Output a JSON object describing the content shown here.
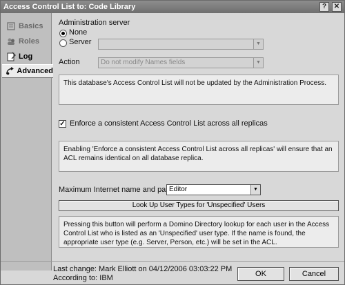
{
  "window": {
    "title": "Access Control List to: Code Library",
    "help_glyph": "?",
    "close_glyph": "✕"
  },
  "sidebar": {
    "items": [
      {
        "label": "Basics",
        "icon": "basics-icon"
      },
      {
        "label": "Roles",
        "icon": "roles-icon"
      },
      {
        "label": "Log",
        "icon": "log-icon"
      },
      {
        "label": "Advanced",
        "icon": "advanced-icon"
      }
    ]
  },
  "admin_server": {
    "heading": "Administration server",
    "none_label": "None",
    "server_label": "Server",
    "server_value": ""
  },
  "action": {
    "label": "Action",
    "value": "Do not modify Names fields"
  },
  "info1": "This database's Access Control List will not be updated by the Administration Process.",
  "enforce": {
    "label": "Enforce a consistent Access Control List across all replicas",
    "checked": true
  },
  "info2": "Enabling 'Enforce a consistent Access Control List across all replicas' will ensure that an ACL remains identical on all database replica.",
  "max_internet": {
    "label": "Maximum Internet name and password",
    "value": "Editor"
  },
  "lookup_button": "Look Up User Types for 'Unspecified' Users",
  "info3": "Pressing this button will perform a Domino Directory lookup for each user in the Access Control List who is listed as an 'Unspecified' user type.  If the name is found, the appropriate user type (e.g. Server, Person, etc.) will be set in the ACL.",
  "footer": {
    "last_change": "Last change: Mark Elliott on 04/12/2006 03:03:22 PM",
    "according_to": "According to: IBM",
    "ok_label": "OK",
    "cancel_label": "Cancel"
  }
}
